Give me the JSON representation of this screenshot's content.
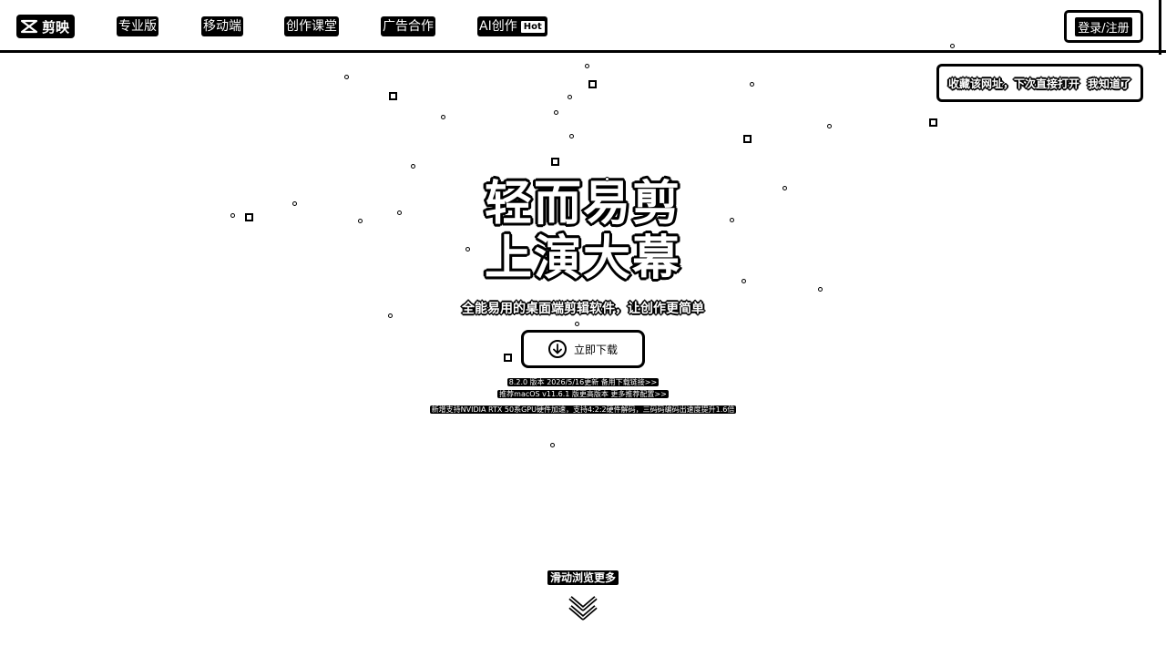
{
  "header": {
    "logo_text": "剪映",
    "nav": [
      {
        "label": "专业版"
      },
      {
        "label": "移动端"
      },
      {
        "label": "创作课堂"
      },
      {
        "label": "广告合作"
      },
      {
        "label": "AI创作",
        "badge": "Hot"
      }
    ],
    "login_label": "登录/注册"
  },
  "bookmark_tip": {
    "text": "收藏该网址，下次直接打开",
    "dismiss_label": "我知道了"
  },
  "hero": {
    "title_line1": "轻而易剪",
    "title_line2": "上演大幕",
    "subtitle": "全能易用的桌面端剪辑软件，让创作更简单",
    "download_label": "立即下载",
    "version_line": "8.2.0 版本 2026/5/16更新 备用下载链接>>",
    "mac_line": "推荐macOS v11.6.1 版更高版本 更多推荐配置>>",
    "feature_line": "新增支持NVIDIA RTX 50系GPU硬件加速，支持4:2:2硬件解码，三码码编码出速度提升1.6倍"
  },
  "scroll": {
    "label": "滑动浏览更多"
  },
  "colors": {
    "background": "#ffffff",
    "ink": "#000000"
  }
}
